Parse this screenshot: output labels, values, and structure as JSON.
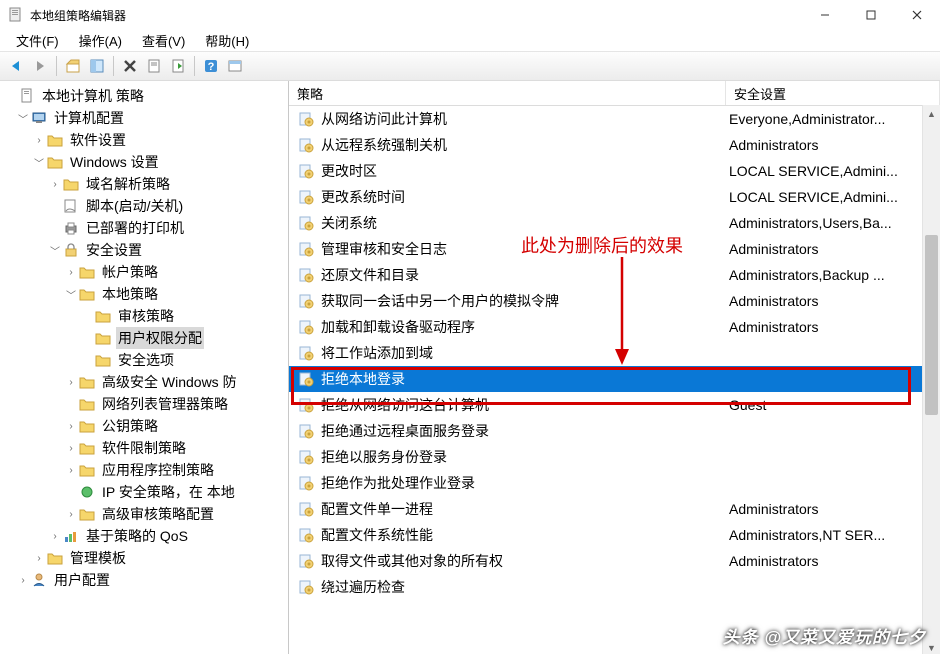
{
  "window": {
    "title": "本地组策略编辑器"
  },
  "menu": {
    "file": "文件(F)",
    "action": "操作(A)",
    "view": "查看(V)",
    "help": "帮助(H)"
  },
  "headers": {
    "policy": "策略",
    "setting": "安全设置"
  },
  "tree": {
    "root": "本地计算机 策略",
    "computer_config": "计算机配置",
    "software_settings": "软件设置",
    "windows_settings": "Windows 设置",
    "name_resolution": "域名解析策略",
    "scripts": "脚本(启动/关机)",
    "deployed_printers": "已部署的打印机",
    "security_settings": "安全设置",
    "account_policies": "帐户策略",
    "local_policies": "本地策略",
    "audit_policy": "审核策略",
    "user_rights": "用户权限分配",
    "security_options": "安全选项",
    "windows_firewall": "高级安全 Windows 防",
    "network_list": "网络列表管理器策略",
    "public_key": "公钥策略",
    "software_restriction": "软件限制策略",
    "app_control": "应用程序控制策略",
    "ip_security": "IP 安全策略，在 本地",
    "advanced_audit": "高级审核策略配置",
    "qos": "基于策略的 QoS",
    "admin_templates": "管理模板",
    "user_config": "用户配置"
  },
  "policies": [
    {
      "name": "从网络访问此计算机",
      "setting": "Everyone,Administrator..."
    },
    {
      "name": "从远程系统强制关机",
      "setting": "Administrators"
    },
    {
      "name": "更改时区",
      "setting": "LOCAL SERVICE,Admini..."
    },
    {
      "name": "更改系统时间",
      "setting": "LOCAL SERVICE,Admini..."
    },
    {
      "name": "关闭系统",
      "setting": "Administrators,Users,Ba..."
    },
    {
      "name": "管理审核和安全日志",
      "setting": "Administrators"
    },
    {
      "name": "还原文件和目录",
      "setting": "Administrators,Backup ..."
    },
    {
      "name": "获取同一会话中另一个用户的模拟令牌",
      "setting": "Administrators"
    },
    {
      "name": "加载和卸载设备驱动程序",
      "setting": "Administrators"
    },
    {
      "name": "将工作站添加到域",
      "setting": ""
    },
    {
      "name": "拒绝本地登录",
      "setting": "",
      "selected": true
    },
    {
      "name": "拒绝从网络访问这台计算机",
      "setting": "Guest"
    },
    {
      "name": "拒绝通过远程桌面服务登录",
      "setting": ""
    },
    {
      "name": "拒绝以服务身份登录",
      "setting": ""
    },
    {
      "name": "拒绝作为批处理作业登录",
      "setting": ""
    },
    {
      "name": "配置文件单一进程",
      "setting": "Administrators"
    },
    {
      "name": "配置文件系统性能",
      "setting": "Administrators,NT SER..."
    },
    {
      "name": "取得文件或其他对象的所有权",
      "setting": "Administrators"
    },
    {
      "name": "绕过遍历检查",
      "setting": ""
    }
  ],
  "annotation": {
    "text": "此处为删除后的效果"
  },
  "watermark": "头条 @又菜又爱玩的七夕"
}
